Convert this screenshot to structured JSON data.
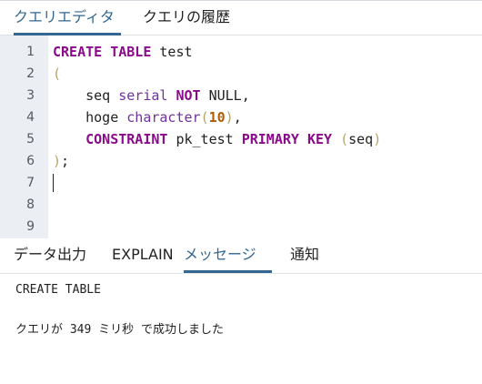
{
  "tabs_top": [
    {
      "label": "クエリエディタ",
      "active": true
    },
    {
      "label": "クエリの履歴",
      "active": false
    }
  ],
  "editor": {
    "lines": [
      {
        "number": "1",
        "tokens": [
          {
            "text": "CREATE TABLE",
            "kind": "keyword"
          },
          {
            "text": " test",
            "kind": "plain"
          }
        ]
      },
      {
        "number": "2",
        "tokens": [
          {
            "text": "(",
            "kind": "paren"
          }
        ]
      },
      {
        "number": "3",
        "tokens": [
          {
            "text": "    seq ",
            "kind": "plain"
          },
          {
            "text": "serial",
            "kind": "type"
          },
          {
            "text": " ",
            "kind": "plain"
          },
          {
            "text": "NOT",
            "kind": "keyword"
          },
          {
            "text": " NULL,",
            "kind": "plain"
          }
        ]
      },
      {
        "number": "4",
        "tokens": [
          {
            "text": "    hoge ",
            "kind": "plain"
          },
          {
            "text": "character",
            "kind": "type"
          },
          {
            "text": "(",
            "kind": "paren"
          },
          {
            "text": "10",
            "kind": "number"
          },
          {
            "text": ")",
            "kind": "paren"
          },
          {
            "text": ",",
            "kind": "plain"
          }
        ]
      },
      {
        "number": "5",
        "tokens": [
          {
            "text": "    ",
            "kind": "plain"
          },
          {
            "text": "CONSTRAINT",
            "kind": "keyword"
          },
          {
            "text": " pk_test ",
            "kind": "plain"
          },
          {
            "text": "PRIMARY KEY",
            "kind": "keyword"
          },
          {
            "text": " ",
            "kind": "plain"
          },
          {
            "text": "(",
            "kind": "paren"
          },
          {
            "text": "seq",
            "kind": "plain"
          },
          {
            "text": ")",
            "kind": "paren"
          }
        ]
      },
      {
        "number": "6",
        "tokens": [
          {
            "text": ")",
            "kind": "paren"
          },
          {
            "text": ";",
            "kind": "plain"
          }
        ]
      },
      {
        "number": "7",
        "tokens": []
      },
      {
        "number": "8",
        "tokens": []
      },
      {
        "number": "9",
        "tokens": []
      }
    ],
    "cursor_line": 7
  },
  "tabs_bottom": [
    {
      "label": "データ出力",
      "active": false
    },
    {
      "label": "EXPLAIN",
      "active": false
    },
    {
      "label": "メッセージ",
      "active": true
    },
    {
      "label": "通知",
      "active": false
    }
  ],
  "messages": {
    "lines": [
      "CREATE TABLE",
      "",
      "クエリが 349 ミリ秒 で成功しました"
    ]
  },
  "colors": {
    "accent": "#336791",
    "gutter_background": "#ebeef2",
    "keyword": "#8b0a8b",
    "type": "#7030a0",
    "number": "#b35a00",
    "paren": "#b0a46a"
  }
}
